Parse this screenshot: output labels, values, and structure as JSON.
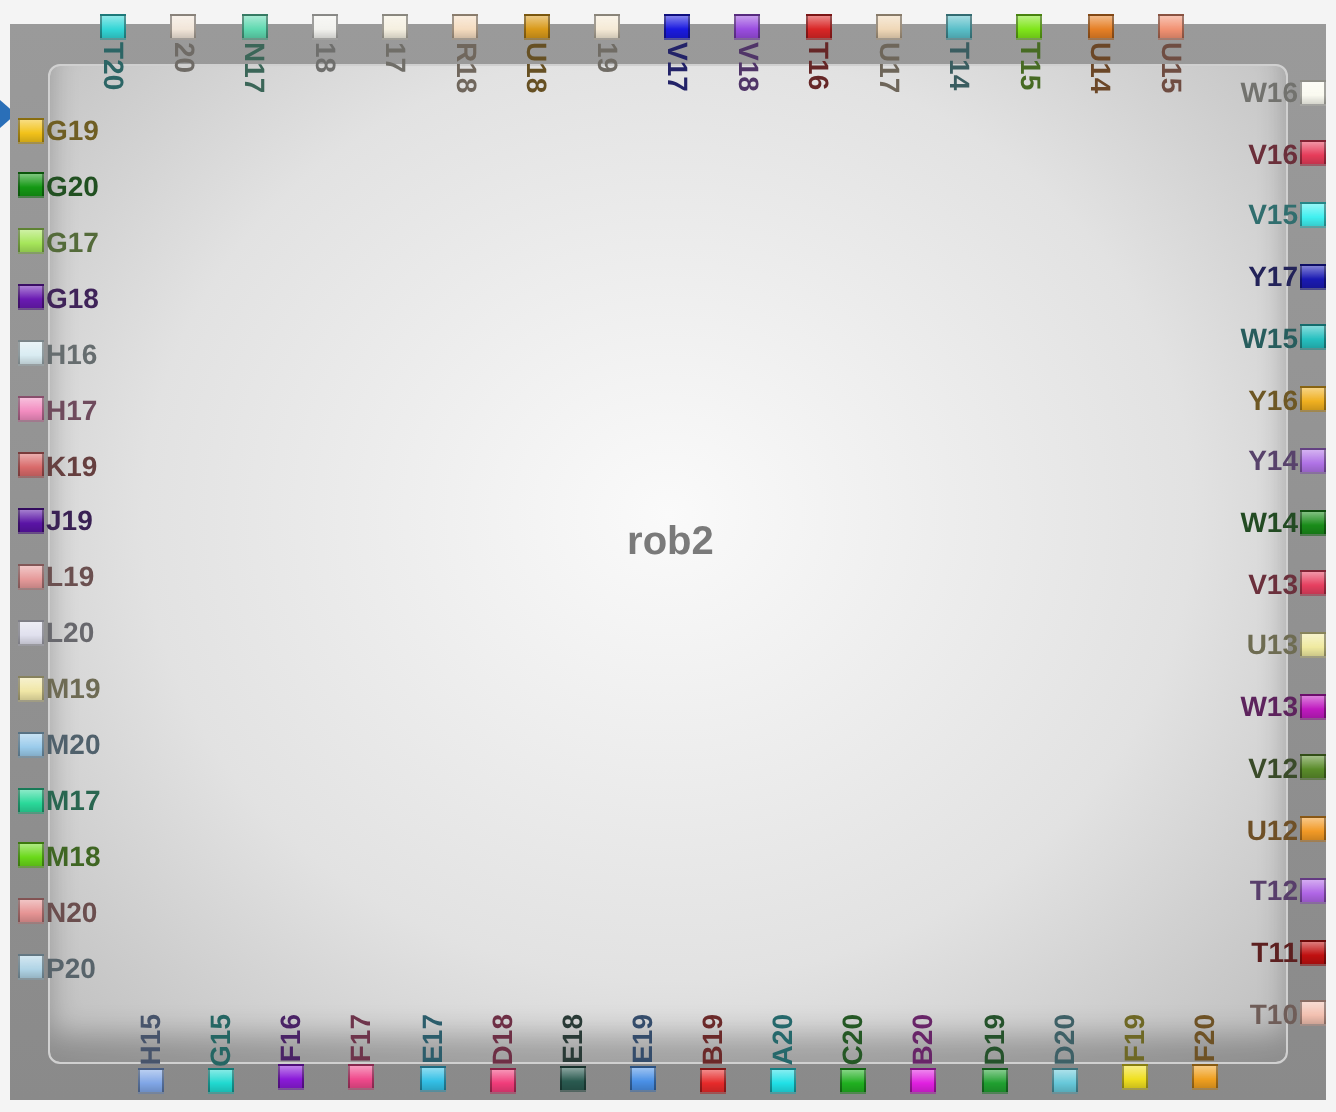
{
  "chip": {
    "name": "rob2",
    "pins": {
      "top": [
        {
          "label": "T20",
          "color": "#33d6d6"
        },
        {
          "label": "20",
          "color": "#f2e6d9"
        },
        {
          "label": "N17",
          "color": "#5fd9b0"
        },
        {
          "label": "18",
          "color": "#f2f2ee"
        },
        {
          "label": "17",
          "color": "#f5f0e0"
        },
        {
          "label": "R18",
          "color": "#f5dcc0"
        },
        {
          "label": "U18",
          "color": "#d99a1a"
        },
        {
          "label": "19",
          "color": "#f5ead6"
        },
        {
          "label": "V17",
          "color": "#1a1ae0"
        },
        {
          "label": "V18",
          "color": "#9a4de0"
        },
        {
          "label": "T16",
          "color": "#d92626"
        },
        {
          "label": "U17",
          "color": "#f0d8b8"
        },
        {
          "label": "T14",
          "color": "#5abfc9"
        },
        {
          "label": "T15",
          "color": "#80e61a"
        },
        {
          "label": "U14",
          "color": "#e68026"
        },
        {
          "label": "U15",
          "color": "#f29273"
        }
      ],
      "left": [
        {
          "label": "G19",
          "color": "#f2c21a"
        },
        {
          "label": "G20",
          "color": "#149914"
        },
        {
          "label": "G17",
          "color": "#a6e65a"
        },
        {
          "label": "G18",
          "color": "#6a1ab3"
        },
        {
          "label": "H16",
          "color": "#d9ecf2"
        },
        {
          "label": "H17",
          "color": "#f28cc0"
        },
        {
          "label": "K19",
          "color": "#d96a6a"
        },
        {
          "label": "J19",
          "color": "#5a14a6"
        },
        {
          "label": "L19",
          "color": "#e69a9a"
        },
        {
          "label": "L20",
          "color": "#e0e0ee"
        },
        {
          "label": "M19",
          "color": "#f0e6a6"
        },
        {
          "label": "M20",
          "color": "#9acbeb"
        },
        {
          "label": "M17",
          "color": "#2ad99a"
        },
        {
          "label": "M18",
          "color": "#6ad91a"
        },
        {
          "label": "N20",
          "color": "#e69494"
        },
        {
          "label": "P20",
          "color": "#b0d4e6"
        }
      ],
      "right": [
        {
          "label": "W16",
          "color": "#fafaf0"
        },
        {
          "label": "V16",
          "color": "#e63c5a"
        },
        {
          "label": "V15",
          "color": "#40f0f0"
        },
        {
          "label": "Y17",
          "color": "#1a1ab3"
        },
        {
          "label": "W15",
          "color": "#26c0c0"
        },
        {
          "label": "Y16",
          "color": "#f0b020"
        },
        {
          "label": "Y14",
          "color": "#b073e6"
        },
        {
          "label": "W14",
          "color": "#1a8c1a"
        },
        {
          "label": "V13",
          "color": "#e64060"
        },
        {
          "label": "U13",
          "color": "#f0eaa0"
        },
        {
          "label": "W13",
          "color": "#c01ac0"
        },
        {
          "label": "V12",
          "color": "#5a8c2a"
        },
        {
          "label": "U12",
          "color": "#f29a26"
        },
        {
          "label": "T12",
          "color": "#b066e6"
        },
        {
          "label": "T11",
          "color": "#c01010"
        },
        {
          "label": "T10",
          "color": "#f2c0b0"
        }
      ],
      "bottom": [
        {
          "label": "H15",
          "color": "#80a6e6"
        },
        {
          "label": "G15",
          "color": "#20d9d0"
        },
        {
          "label": "F16",
          "color": "#8a1ad9"
        },
        {
          "label": "F17",
          "color": "#f04a8c"
        },
        {
          "label": "E17",
          "color": "#33c0e6"
        },
        {
          "label": "D18",
          "color": "#f03c7a"
        },
        {
          "label": "E18",
          "color": "#2a5a50"
        },
        {
          "label": "E19",
          "color": "#4a90e6"
        },
        {
          "label": "B19",
          "color": "#e62a2a"
        },
        {
          "label": "A20",
          "color": "#20e0e6"
        },
        {
          "label": "C20",
          "color": "#20b020"
        },
        {
          "label": "B20",
          "color": "#e020e0"
        },
        {
          "label": "D19",
          "color": "#20a030"
        },
        {
          "label": "D20",
          "color": "#66c8d9"
        },
        {
          "label": "F19",
          "color": "#f0e020"
        },
        {
          "label": "F20",
          "color": "#f0a020"
        }
      ]
    }
  }
}
